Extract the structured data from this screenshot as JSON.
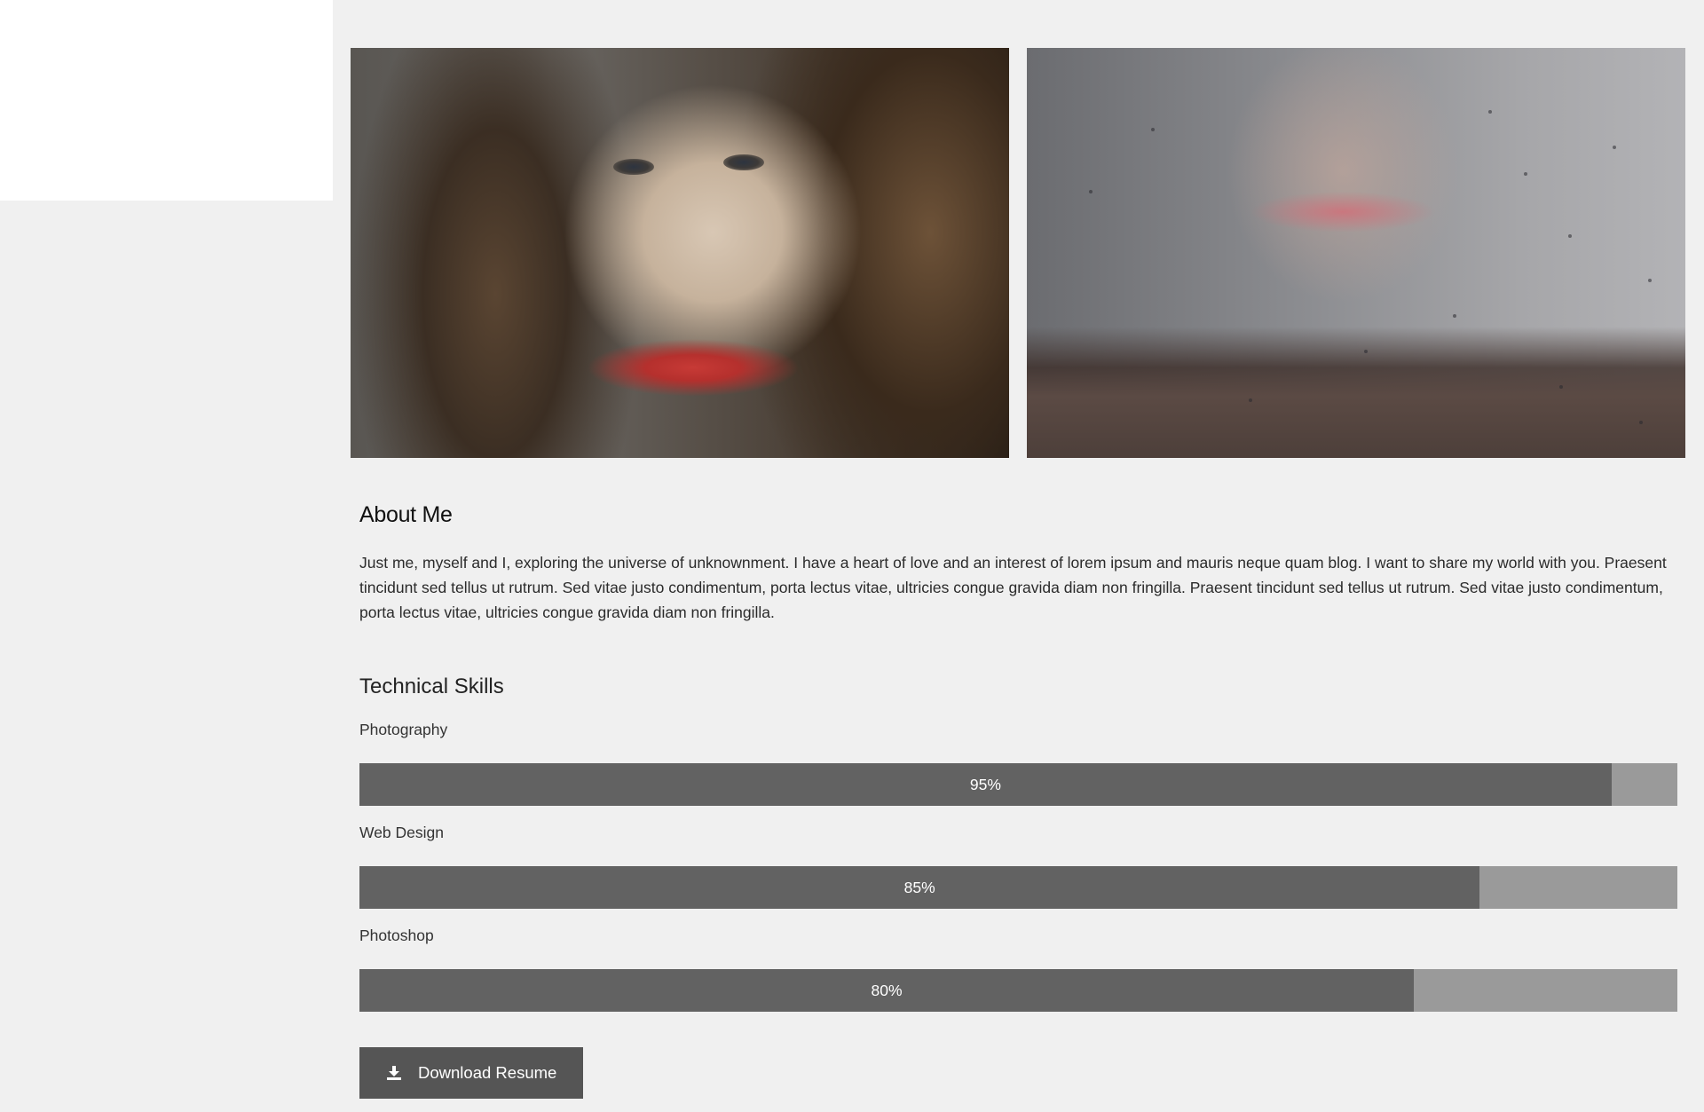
{
  "about": {
    "title": "About Me",
    "text": "Just me, myself and I, exploring the universe of unknownment. I have a heart of love and an interest of lorem ipsum and mauris neque quam blog. I want to share my world with you. Praesent tincidunt sed tellus ut rutrum. Sed vitae justo condimentum, porta lectus vitae, ultricies congue gravida diam non fringilla. Praesent tincidunt sed tellus ut rutrum. Sed vitae justo condimentum, porta lectus vitae, ultricies congue gravida diam non fringilla."
  },
  "skills": {
    "title": "Technical Skills",
    "items": [
      {
        "label": "Photography",
        "percent": 95,
        "percent_label": "95%"
      },
      {
        "label": "Web Design",
        "percent": 85,
        "percent_label": "85%"
      },
      {
        "label": "Photoshop",
        "percent": 80,
        "percent_label": "80%"
      }
    ]
  },
  "actions": {
    "download_label": "Download Resume",
    "download_icon": "download-icon"
  },
  "colors": {
    "page_background": "#f0f0f0",
    "bar_fill": "#626262",
    "bar_track": "#9a9a9a",
    "button_background": "#555555"
  }
}
